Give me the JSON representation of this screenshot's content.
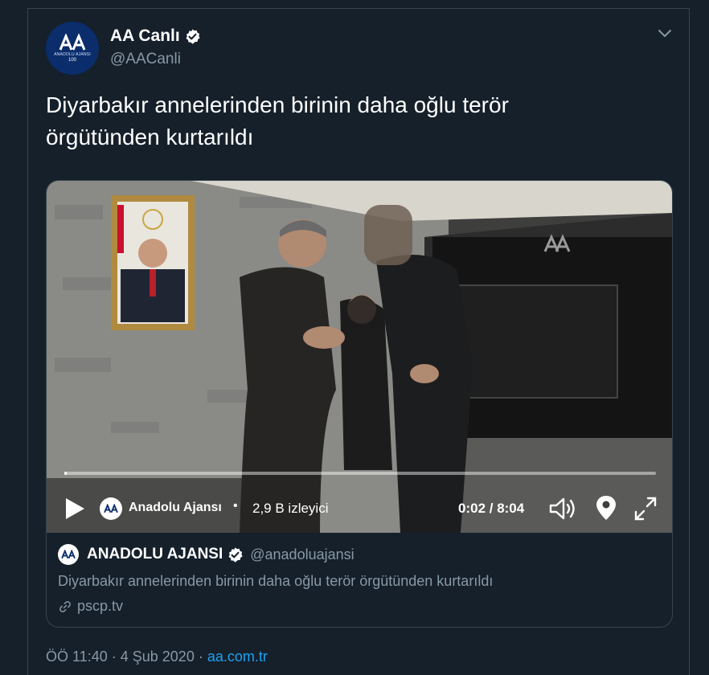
{
  "tweet": {
    "display_name": "AA Canlı",
    "handle": "@AACanli",
    "text": "Diyarbakır annelerinden birinin daha oğlu terör örgütünden kurtarıldı",
    "avatar": {
      "brand": "ANADOLU AJANSI",
      "year": "100"
    },
    "footer": {
      "time": "ÖÖ 11:40",
      "separator": "·",
      "date": "4 Şub 2020",
      "separator2": "·",
      "source": "aa.com.tr"
    }
  },
  "video": {
    "source_name": "Anadolu Ajansı",
    "dot": "•",
    "viewers": "2,9 B izleyici",
    "time": "0:02 / 8:04",
    "progress": 0.004
  },
  "card": {
    "name": "ANADOLU AJANSI",
    "handle": "@anadoluajansi",
    "description": "Diyarbakır annelerinden birinin daha oğlu terör örgütünden kurtarıldı",
    "link": "pscp.tv"
  },
  "colors": {
    "background": "#15202b",
    "border": "#38444d",
    "secondary_text": "#8899a6",
    "accent": "#1da1f2",
    "aa_brand": "#0b2d6b"
  },
  "icons": {
    "verified": "verified-badge-icon",
    "caret": "chevron-down-icon",
    "play": "play-icon",
    "volume": "volume-icon",
    "location": "location-pin-icon",
    "fullscreen": "fullscreen-icon",
    "link": "link-icon"
  }
}
